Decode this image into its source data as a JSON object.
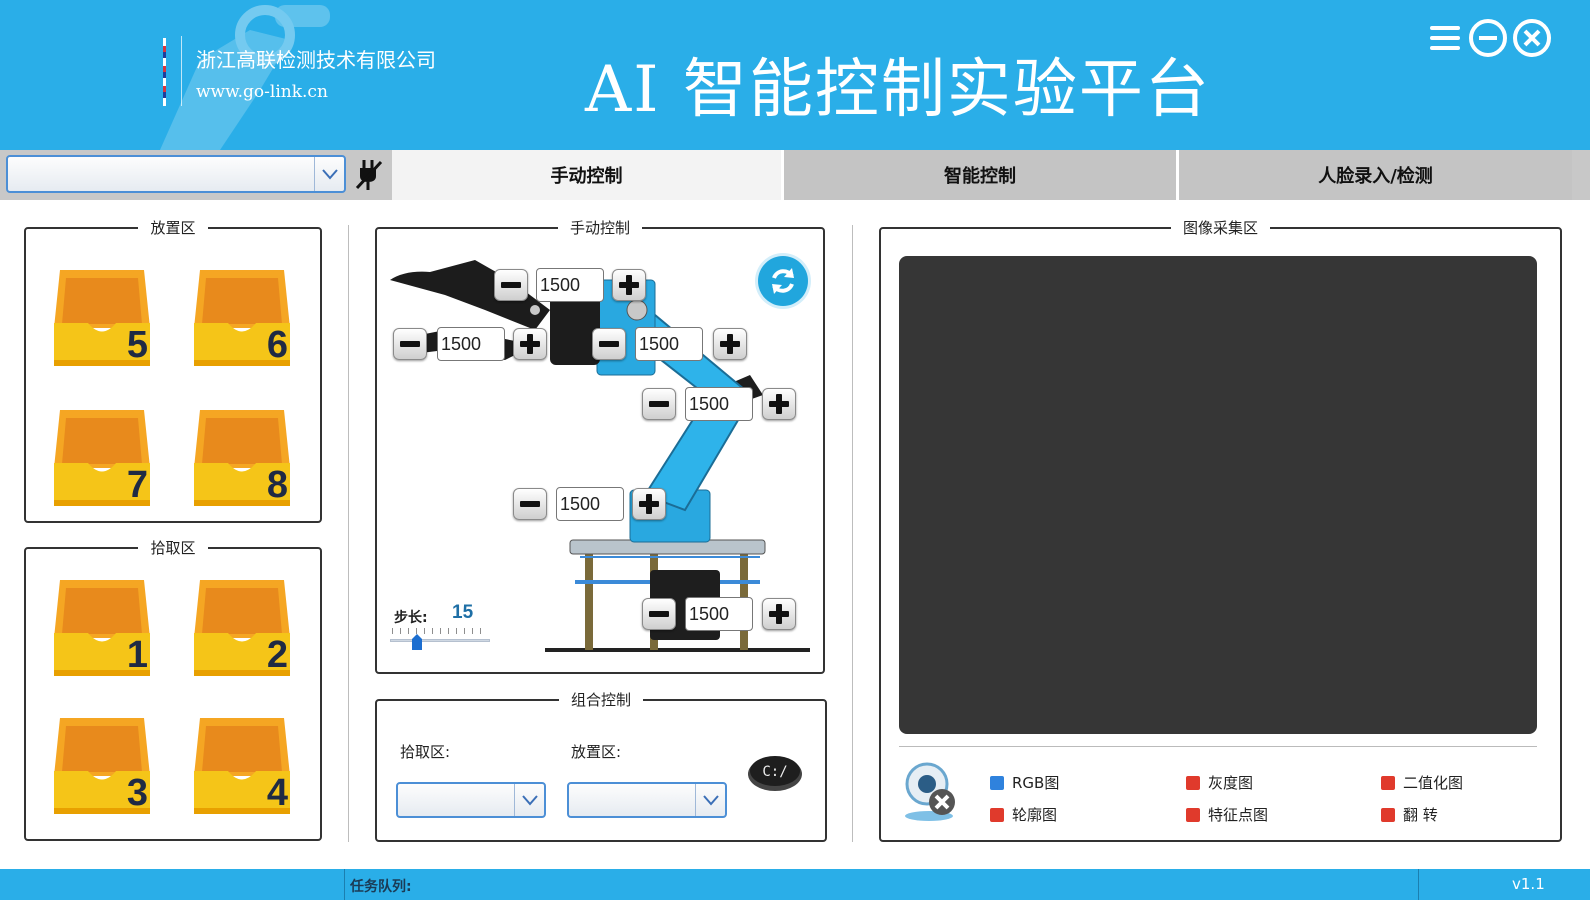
{
  "header": {
    "company": "浙江高联检测技术有限公司",
    "website": "www.go-link.cn",
    "title": "AI 智能控制实验平台"
  },
  "window_controls": [
    "menu-icon",
    "minimize-icon",
    "close-icon"
  ],
  "toolbar": {
    "port_select_value": "",
    "tabs": [
      {
        "label": "手动控制",
        "active": true
      },
      {
        "label": "智能控制",
        "active": false
      },
      {
        "label": "人脸录入/检测",
        "active": false
      }
    ]
  },
  "place_zone": {
    "title": "放置区",
    "trays": [
      "5",
      "6",
      "7",
      "8"
    ]
  },
  "pick_zone": {
    "title": "拾取区",
    "trays": [
      "1",
      "2",
      "3",
      "4"
    ]
  },
  "manual": {
    "title": "手动控制",
    "servos": [
      {
        "value": "1500"
      },
      {
        "value": "1500"
      },
      {
        "value": "1500"
      },
      {
        "value": "1500"
      },
      {
        "value": "1500"
      },
      {
        "value": "1500"
      }
    ],
    "step_label": "步长:",
    "step_value": "15",
    "step_slider_fraction": 0.27
  },
  "combo": {
    "title": "组合控制",
    "pick_label": "拾取区:",
    "place_label": "放置区:",
    "pick_value": "",
    "place_value": ""
  },
  "image": {
    "title": "图像采集区",
    "options": [
      {
        "label": "RGB图",
        "color": "#2f82dd"
      },
      {
        "label": "灰度图",
        "color": "#e03a2c"
      },
      {
        "label": "二值化图",
        "color": "#e03a2c"
      },
      {
        "label": "轮廓图",
        "color": "#e03a2c"
      },
      {
        "label": "特征点图",
        "color": "#e03a2c"
      },
      {
        "label": "翻 转",
        "color": "#e03a2c"
      }
    ]
  },
  "status": {
    "queue_label": "任务队列:",
    "version": "v1.1"
  },
  "colors": {
    "primary": "#2aaee8",
    "accent": "#1e6fa6",
    "screen": "#363636"
  }
}
